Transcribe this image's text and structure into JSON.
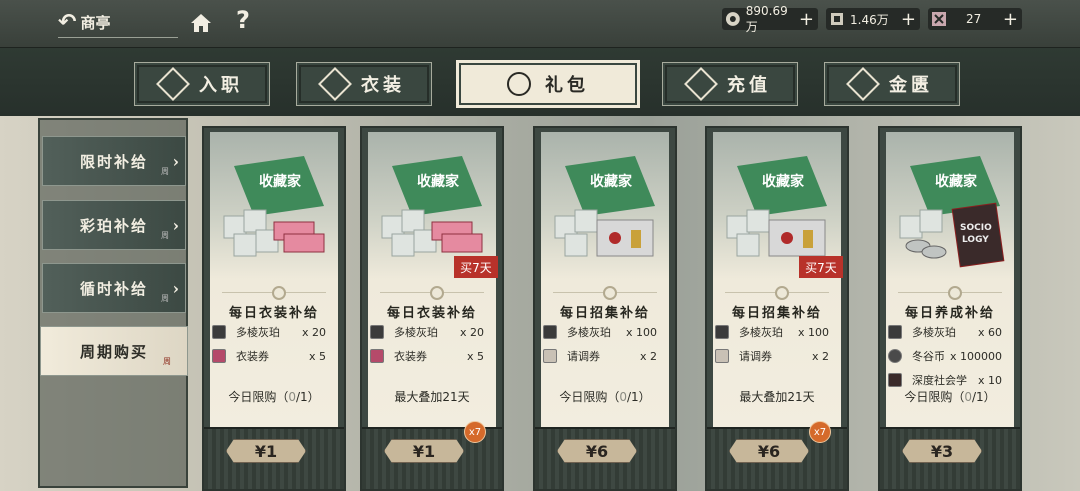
{
  "topbar": {
    "back_label": "商亭",
    "help_label": "?",
    "currencies": [
      {
        "icon": "coin-icon",
        "value": "890.69万"
      },
      {
        "icon": "amber-icon",
        "value": "1.46万"
      },
      {
        "icon": "ticket-icon",
        "value": "27"
      }
    ],
    "plus_label": "+"
  },
  "tabs": [
    {
      "label": "入职",
      "active": false
    },
    {
      "label": "衣装",
      "active": false
    },
    {
      "label": "礼包",
      "active": true
    },
    {
      "label": "充值",
      "active": false
    },
    {
      "label": "金匮",
      "active": false
    }
  ],
  "sidebar": {
    "items": [
      {
        "label": "限时补给",
        "tag": "周",
        "active": false
      },
      {
        "label": "彩珀补给",
        "tag": "周",
        "active": false
      },
      {
        "label": "循时补给",
        "tag": "周",
        "active": false
      },
      {
        "label": "周期购买",
        "tag": "周",
        "active": true
      }
    ]
  },
  "cards": [
    {
      "badge": "",
      "title": "每日衣装补给",
      "items": [
        {
          "name": "多棱灰珀",
          "qty": "x 20"
        },
        {
          "name": "衣装券",
          "qty": "x 5"
        }
      ],
      "footer_text": "今日限购（",
      "footer_count": "0",
      "footer_limit": "/1）",
      "price": "¥1",
      "multiplier": ""
    },
    {
      "badge": "买7天",
      "title": "每日衣装补给",
      "items": [
        {
          "name": "多棱灰珀",
          "qty": "x 20"
        },
        {
          "name": "衣装券",
          "qty": "x 5"
        }
      ],
      "footer_text": "最大叠加21天",
      "footer_count": "",
      "footer_limit": "",
      "price": "¥1",
      "multiplier": "x7"
    },
    {
      "badge": "",
      "title": "每日招集补给",
      "items": [
        {
          "name": "多棱灰珀",
          "qty": "x 100"
        },
        {
          "name": "请调券",
          "qty": "x 2"
        }
      ],
      "footer_text": "今日限购（",
      "footer_count": "0",
      "footer_limit": "/1）",
      "price": "¥6",
      "multiplier": ""
    },
    {
      "badge": "买7天",
      "title": "每日招集补给",
      "items": [
        {
          "name": "多棱灰珀",
          "qty": "x 100"
        },
        {
          "name": "请调券",
          "qty": "x 2"
        }
      ],
      "footer_text": "最大叠加21天",
      "footer_count": "",
      "footer_limit": "",
      "price": "¥6",
      "multiplier": "x7"
    },
    {
      "badge": "",
      "title": "每日养成补给",
      "items": [
        {
          "name": "多棱灰珀",
          "qty": "x 60"
        },
        {
          "name": "冬谷币",
          "qty": "x 100000"
        },
        {
          "name": "深度社会学",
          "qty": "x 10"
        }
      ],
      "footer_text": "今日限购（",
      "footer_count": "0",
      "footer_limit": "/1）",
      "price": "¥3",
      "multiplier": ""
    }
  ],
  "colors": {
    "accent": "#c7b79a",
    "badge_red": "#b8322a",
    "multiplier_orange": "#d56a2b"
  }
}
